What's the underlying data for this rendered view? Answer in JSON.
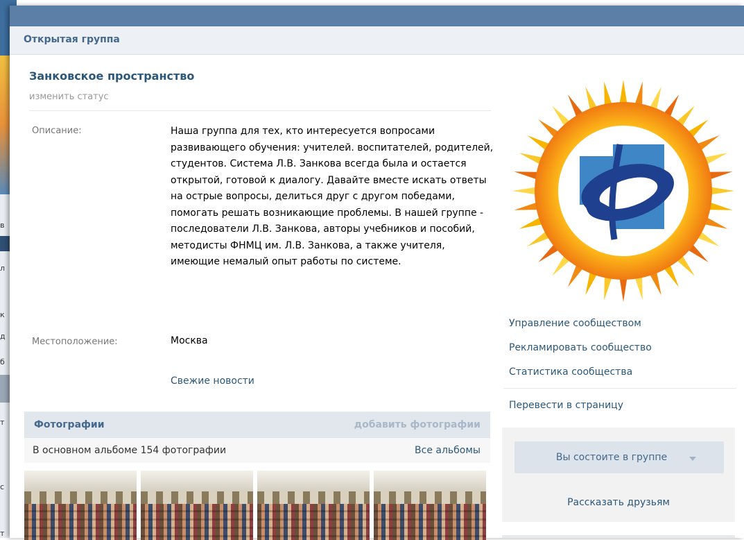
{
  "background_fragments": [
    "в",
    "л",
    "к",
    "д",
    "б",
    "т",
    "с",
    "т"
  ],
  "group": {
    "header": "Открытая группа",
    "title": "Занковское пространство",
    "status_link": "изменить статус",
    "description_label": "Описание:",
    "description": "Наша группа для тех, кто интересуется вопросами развивающего обучения: учителей. воспитателей, родителей, студентов. Система Л.В. Занкова всегда была и остается открытой, готовой к диалогу. Давайте вместе искать ответы на острые вопросы, делиться друг с другом победами, помогать решать возникающие проблемы. В нашей группе - последователи Л.В. Занкова, авторы учебников и пособий, методисты ФНМЦ им. Л.В. Занкова, а также учителя, имеющие немалый опыт работы по системе.",
    "location_label": "Местоположение:",
    "location": "Москва",
    "news_link": "Свежие новости"
  },
  "photos": {
    "title": "Фотографии",
    "add_link": "добавить фотографии",
    "album_text": "В основном альбоме 154 фотографии",
    "all_albums_link": "Все альбомы",
    "thumbnails": [
      "photo-1",
      "photo-2",
      "photo-3",
      "photo-4"
    ]
  },
  "sidebar": {
    "logo_icon": "fnmc-sun-logo-icon",
    "links": [
      "Управление сообществом",
      "Рекламировать сообщество",
      "Статистика сообщества"
    ],
    "convert_link": "Перевести в страницу",
    "member_button": "Вы состоите в группе",
    "tell_friends": "Рассказать друзьям"
  },
  "colors": {
    "topbar": "#5b7fa6",
    "link": "#2b587a",
    "header_text": "#45688e",
    "muted": "#999999"
  }
}
